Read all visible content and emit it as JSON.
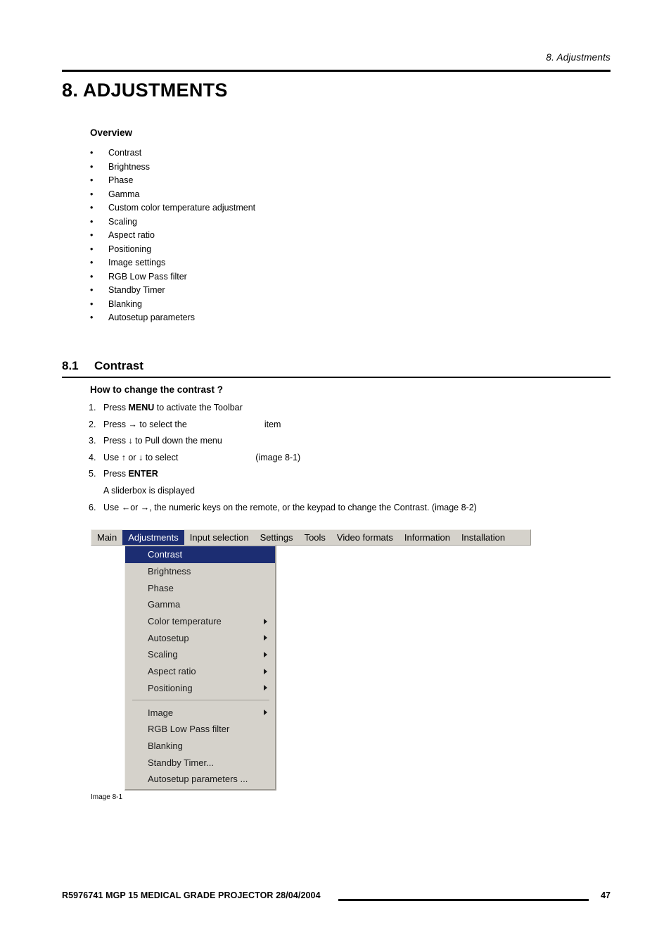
{
  "header": {
    "running_head": "8.  Adjustments",
    "chapter_title": "8. ADJUSTMENTS"
  },
  "overview": {
    "heading": "Overview",
    "bullet": "•",
    "items": [
      "Contrast",
      "Brightness",
      "Phase",
      "Gamma",
      "Custom color temperature adjustment",
      "Scaling",
      "Aspect ratio",
      "Positioning",
      "Image settings",
      "RGB Low Pass filter",
      "Standby Timer",
      "Blanking",
      "Autosetup parameters"
    ]
  },
  "section": {
    "number": "8.1",
    "title": "Contrast",
    "howto_heading": "How to change the contrast ?",
    "steps": [
      {
        "num": "1.",
        "prefix": "Press ",
        "strong": "MENU",
        "suffix": " to activate the Toolbar",
        "gap": false
      },
      {
        "num": "2.",
        "prefix": "Press → to select the",
        "strong": "",
        "suffix": "item",
        "gap": true
      },
      {
        "num": "3.",
        "prefix": "Press ↓ to Pull down the menu",
        "strong": "",
        "suffix": "",
        "gap": false
      },
      {
        "num": "4.",
        "prefix": "Use ↑ or ↓ to select",
        "strong": "",
        "suffix": "(image 8-1)",
        "gap": true
      },
      {
        "num": "5.",
        "prefix": "Press ",
        "strong": "ENTER",
        "suffix": "",
        "gap": false
      }
    ],
    "note": "A sliderbox is displayed",
    "last_step": {
      "num": "6.",
      "text": "Use ←or →, the numeric keys on the remote, or the keypad to change the Contrast.  (image 8-2)"
    }
  },
  "osd": {
    "menubar": [
      {
        "label": "Main",
        "selected": false
      },
      {
        "label": "Adjustments",
        "selected": true
      },
      {
        "label": "Input selection",
        "selected": false
      },
      {
        "label": "Settings",
        "selected": false
      },
      {
        "label": "Tools",
        "selected": false
      },
      {
        "label": "Video formats",
        "selected": false
      },
      {
        "label": "Information",
        "selected": false
      },
      {
        "label": "Installation",
        "selected": false
      }
    ],
    "dropdown_group_1": [
      {
        "label": "Contrast",
        "highlighted": true,
        "submenu": false
      },
      {
        "label": "Brightness",
        "highlighted": false,
        "submenu": false
      },
      {
        "label": "Phase",
        "highlighted": false,
        "submenu": false
      },
      {
        "label": "Gamma",
        "highlighted": false,
        "submenu": false
      },
      {
        "label": "Color temperature",
        "highlighted": false,
        "submenu": true
      },
      {
        "label": "Autosetup",
        "highlighted": false,
        "submenu": true
      },
      {
        "label": "Scaling",
        "highlighted": false,
        "submenu": true
      },
      {
        "label": "Aspect ratio",
        "highlighted": false,
        "submenu": true
      },
      {
        "label": "Positioning",
        "highlighted": false,
        "submenu": true
      }
    ],
    "dropdown_group_2": [
      {
        "label": "Image",
        "highlighted": false,
        "submenu": true
      },
      {
        "label": "RGB Low Pass filter",
        "highlighted": false,
        "submenu": false
      },
      {
        "label": "Blanking",
        "highlighted": false,
        "submenu": false
      },
      {
        "label": "Standby Timer...",
        "highlighted": false,
        "submenu": false
      },
      {
        "label": "Autosetup parameters ...",
        "highlighted": false,
        "submenu": false
      }
    ],
    "caption": "Image 8-1",
    "colors": {
      "menu_background": "#d5d2cb",
      "highlight": "#1c2d72",
      "highlight_text": "#ffffff",
      "border_shadow": "#9d9a93"
    }
  },
  "footer": {
    "doc_ref": "R5976741  MGP 15 MEDICAL GRADE PROJECTOR  28/04/2004",
    "page_number": "47"
  }
}
